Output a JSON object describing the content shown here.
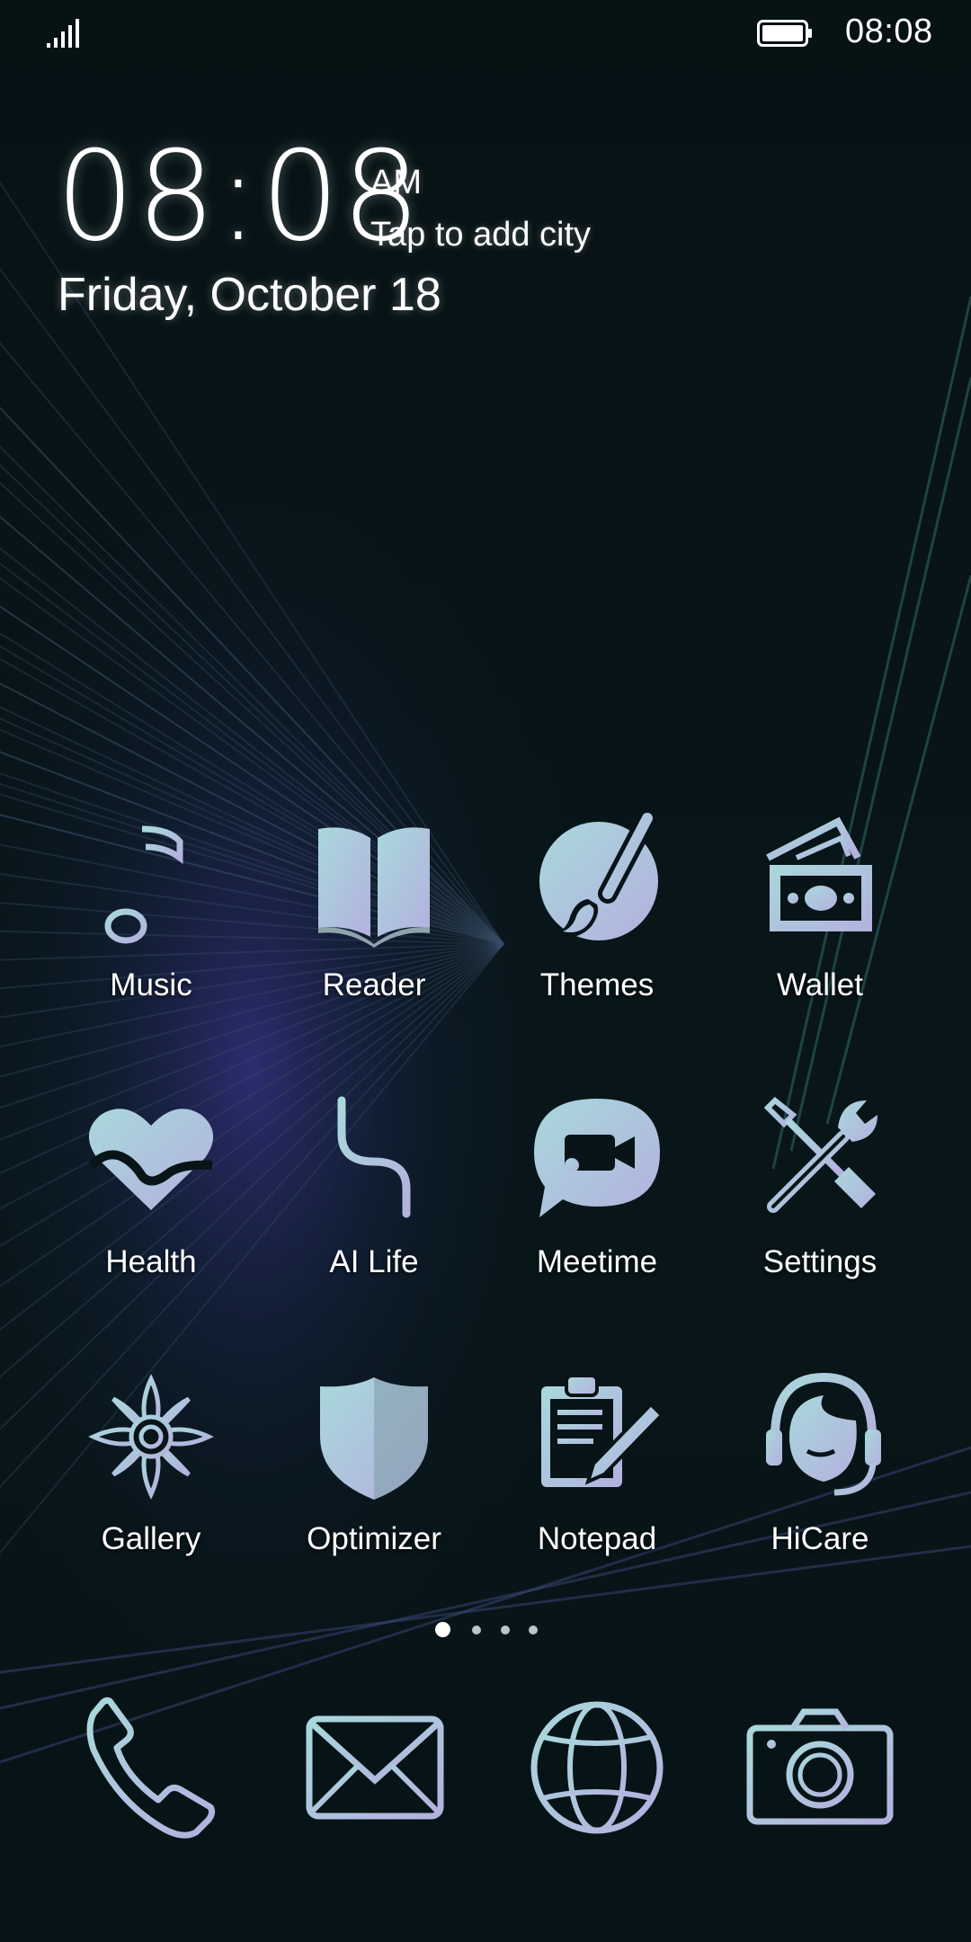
{
  "status_bar": {
    "time": "08:08",
    "signal_icon": "signal-strength-icon",
    "battery_icon": "battery-full-icon"
  },
  "clock_widget": {
    "time": "08:08",
    "ampm": "AM",
    "city_prompt": "Tap to add city",
    "date": "Friday, October 18"
  },
  "apps": [
    {
      "label": "Music",
      "icon": "music-note-icon"
    },
    {
      "label": "Reader",
      "icon": "open-book-icon"
    },
    {
      "label": "Themes",
      "icon": "paint-brush-icon"
    },
    {
      "label": "Wallet",
      "icon": "wallet-cash-icon"
    },
    {
      "label": "Health",
      "icon": "heart-pulse-icon"
    },
    {
      "label": "AI Life",
      "icon": "ai-life-icon"
    },
    {
      "label": "Meetime",
      "icon": "video-chat-icon"
    },
    {
      "label": "Settings",
      "icon": "wrench-screwdriver-icon"
    },
    {
      "label": "Gallery",
      "icon": "flower-icon"
    },
    {
      "label": "Optimizer",
      "icon": "shield-icon"
    },
    {
      "label": "Notepad",
      "icon": "clipboard-pencil-icon"
    },
    {
      "label": "HiCare",
      "icon": "headset-icon"
    }
  ],
  "page_indicator": {
    "pages": 4,
    "current": 1
  },
  "dock": [
    {
      "icon": "phone-icon"
    },
    {
      "icon": "mail-icon"
    },
    {
      "icon": "globe-icon"
    },
    {
      "icon": "camera-icon"
    }
  ],
  "colors": {
    "background": "#081417",
    "icon_gradient_start": "#a9d8dc",
    "icon_gradient_end": "#b0b0dd",
    "accent_glow": "#5a4fd0"
  }
}
